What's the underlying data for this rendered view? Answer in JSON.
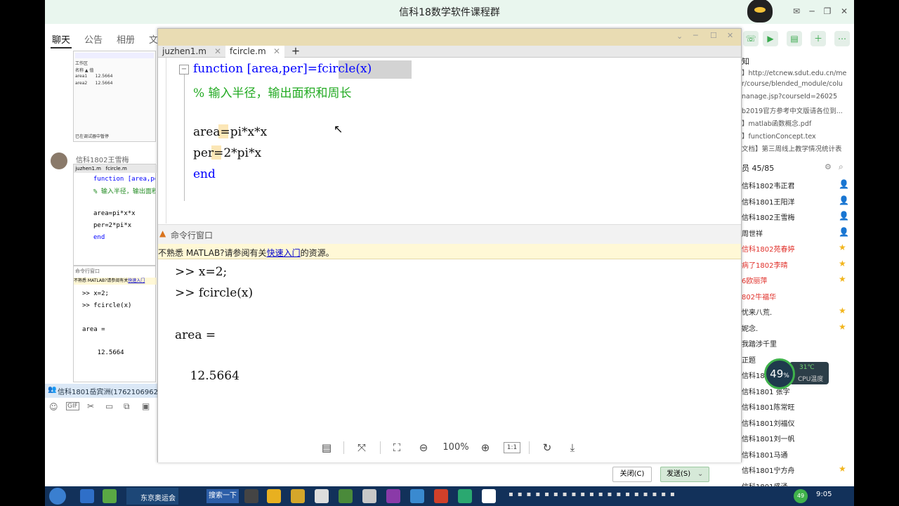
{
  "qq": {
    "title": "信科18数学软件课程群",
    "tabs": [
      "聊天",
      "公告",
      "相册",
      "文"
    ],
    "sender_name": "信科1802王雪梅",
    "input_bar_text": "信科1801岳宾洲(1762106962)",
    "close_label": "关闭(C)",
    "send_label": "发送(S)",
    "notice_title": "知",
    "notice_lines": [
      "】http://etcnew.sdut.edu.cn/me",
      "r/course/blended_module/colu",
      "nanage.jsp?courseId=26025",
      "b2019官方参考中文版请各位到...",
      "】matlab函数概念.pdf",
      "】functionConcept.tex",
      "文档】第三周线上教学情况统计表"
    ],
    "members_header": "员 45/85",
    "members": [
      {
        "name": "信科1802韦正君",
        "icon": "person-icon",
        "red": false
      },
      {
        "name": "信科1801王阳洋",
        "icon": "person-icon",
        "red": false
      },
      {
        "name": "信科1802王雪梅",
        "icon": "person-icon",
        "red": false
      },
      {
        "name": "周世祥",
        "icon": "person-icon",
        "red": false
      },
      {
        "name": "信科1802苑春婷",
        "icon": "star-icon",
        "red": true
      },
      {
        "name": "病了1802李晴",
        "icon": "star-icon",
        "red": true
      },
      {
        "name": "6欧丽萍",
        "icon": "star-icon",
        "red": true
      },
      {
        "name": "802牛福华",
        "icon": "",
        "red": true
      },
      {
        "name": "忧来八荒.",
        "icon": "star-icon",
        "red": false
      },
      {
        "name": "妮念.",
        "icon": "star-icon",
        "red": false
      },
      {
        "name": "我踏涉千里",
        "icon": "",
        "red": false
      },
      {
        "name": "正题",
        "icon": "",
        "red": false
      },
      {
        "name": "信科180",
        "icon": "",
        "red": false
      },
      {
        "name": "信科1801 张字",
        "icon": "",
        "red": false
      },
      {
        "name": "信科1801陈常旺",
        "icon": "",
        "red": false
      },
      {
        "name": "信科1801刘福仪",
        "icon": "",
        "red": false
      },
      {
        "name": "信科1801刘一帆",
        "icon": "",
        "red": false
      },
      {
        "name": "信科1801马通",
        "icon": "",
        "red": false
      },
      {
        "name": "信科1801宁方舟",
        "icon": "star-icon",
        "red": false
      },
      {
        "name": "信科1801盛涌",
        "icon": "",
        "red": false
      }
    ]
  },
  "thumb": {
    "workspace_rows": [
      {
        "name": "area",
        "value": "12.5664"
      },
      {
        "name": "area1",
        "value": "12.5664"
      },
      {
        "name": "area2",
        "value": "12.5664"
      }
    ],
    "workspace_head": "名称 ▲    值",
    "status": "已在调试器中暂停"
  },
  "matlab": {
    "tabs": [
      "juzhen1.m",
      "fcircle.m"
    ],
    "code_lines": [
      "function [area,per]=fcircle(x)",
      "% 输入半径，输出面积和周长",
      "",
      "area=pi*x*x",
      "per=2*pi*x",
      "end"
    ],
    "cmd_title": "命令行窗口",
    "banner_pre": "不熟悉 MATLAB?请参阅有关",
    "banner_link": "快速入门",
    "banner_post": "的资源。",
    "cmd_lines": [
      ">> x=2;",
      ">> fcircle(x)",
      "",
      "area =",
      "",
      "    12.5664"
    ]
  },
  "viewer": {
    "zoom": "100%",
    "ratio": "1:1"
  },
  "taskbar": {
    "search_label": "搜索一下",
    "app_label": "东京奥运会",
    "time": "9:05"
  },
  "cpu": {
    "percent": "49",
    "unit": "%",
    "temp": "31℃",
    "label": "CPU温度"
  }
}
